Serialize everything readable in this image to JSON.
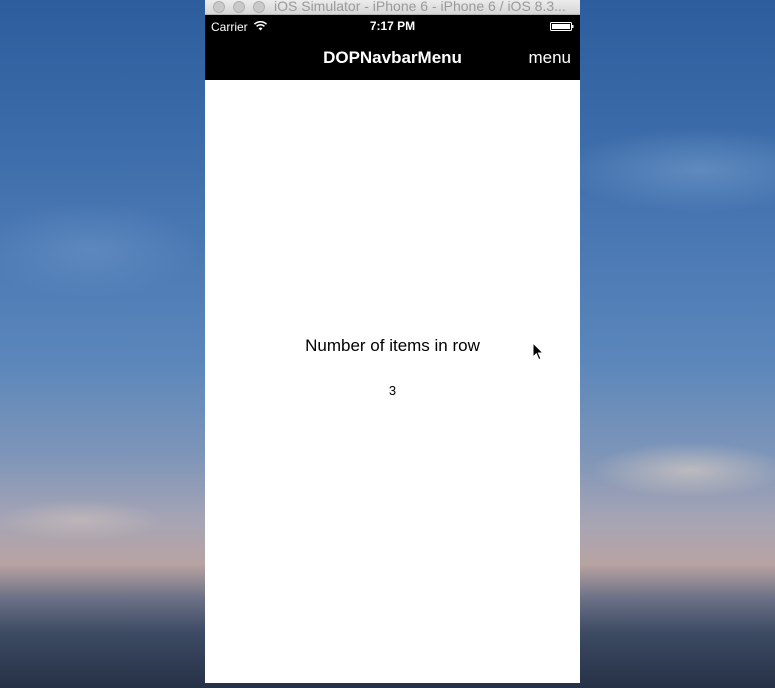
{
  "simulator": {
    "title": "iOS Simulator - iPhone 6 - iPhone 6 / iOS 8.3..."
  },
  "status_bar": {
    "carrier": "Carrier",
    "time": "7:17 PM",
    "icons": [
      "wifi-icon",
      "battery-icon"
    ]
  },
  "navbar": {
    "title": "DOPNavbarMenu",
    "menu_label": "menu",
    "background": "#000000",
    "text_color": "#ffffff"
  },
  "content": {
    "label": "Number of items in row",
    "value": "3"
  }
}
